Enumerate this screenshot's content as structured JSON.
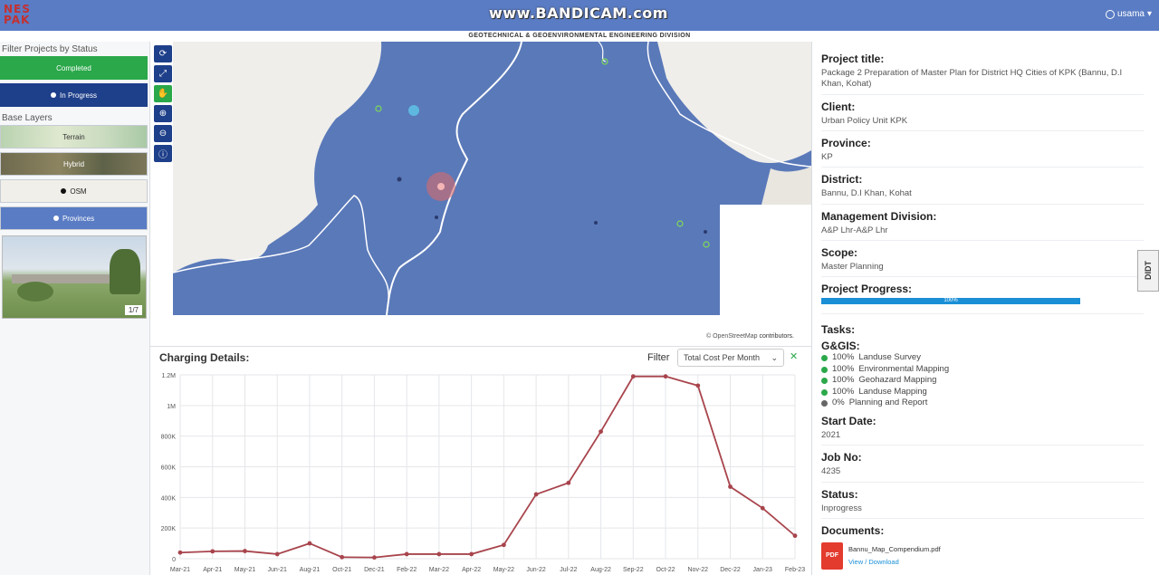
{
  "header": {
    "logo_text": "NESPAK",
    "watermark": "www.BANDICAM.com",
    "user": "usama",
    "division_title": "GEOTECHNICAL & GEOENVIRONMENTAL ENGINEERING DIVISION"
  },
  "left": {
    "filter_title": "Filter Projects by Status",
    "status_buttons": [
      "Completed",
      "In Progress"
    ],
    "base_layers_title": "Base Layers",
    "layers": [
      "Terrain",
      "Hybrid",
      "OSM",
      "Provinces"
    ],
    "photo_counter": "1/7"
  },
  "map": {
    "attribution_prefix": "© OpenStreetMap",
    "attribution_suffix": "contributors."
  },
  "charging": {
    "title": "Charging Details:",
    "filter_label": "Filter",
    "filter_value": "Total Cost Per Month",
    "close_symbol": "✕"
  },
  "chart_data": {
    "type": "line",
    "title": "",
    "xlabel": "",
    "ylabel": "",
    "x": [
      "Mar-21",
      "Apr-21",
      "May-21",
      "Jun-21",
      "Aug-21",
      "Oct-21",
      "Dec-21",
      "Feb-22",
      "Mar-22",
      "Apr-22",
      "May-22",
      "Jun-22",
      "Jul-22",
      "Aug-22",
      "Sep-22",
      "Oct-22",
      "Nov-22",
      "Dec-22",
      "Jan-23",
      "Feb-23"
    ],
    "series": [
      {
        "values": [
          40000,
          48000,
          50000,
          30000,
          100000,
          10000,
          8000,
          30000,
          30000,
          30000,
          90000,
          420000,
          495000,
          830000,
          1190000,
          1190000,
          1130000,
          470000,
          330000,
          150000
        ]
      }
    ],
    "ylim": [
      0,
      1200000
    ],
    "y_ticks": [
      "0",
      "200K",
      "400K",
      "600K",
      "800K",
      "1M",
      "1.2M"
    ],
    "grid": true,
    "line_color": "#a8444c"
  },
  "project": {
    "title_label": "Project title:",
    "title_value": "Package 2 Preparation of Master Plan for District HQ Cities of KPK (Bannu, D.I Khan, Kohat)",
    "client_label": "Client:",
    "client_value": "Urban Policy Unit KPK",
    "province_label": "Province:",
    "province_value": "KP",
    "district_label": "District:",
    "district_value": "Bannu, D.I Khan, Kohat",
    "mgmt_label": "Management Division:",
    "mgmt_value": "A&P Lhr-A&P Lhr",
    "scope_label": "Scope:",
    "scope_value": "Master Planning",
    "progress_label": "Project Progress:",
    "progress_value": "100%",
    "progress_fraction": 1.0,
    "tasks_label": "Tasks:",
    "tasks_group": "G&GIS:",
    "tasks": [
      {
        "pct": "100%",
        "name": "Landuse Survey",
        "done": true
      },
      {
        "pct": "100%",
        "name": "Environmental Mapping",
        "done": true
      },
      {
        "pct": "100%",
        "name": "Geohazard Mapping",
        "done": true
      },
      {
        "pct": "100%",
        "name": "Landuse Mapping",
        "done": true
      },
      {
        "pct": "0%",
        "name": "Planning and Report",
        "done": false
      }
    ],
    "start_label": "Start Date:",
    "start_value": "2021",
    "job_label": "Job No:",
    "job_value": "4235",
    "status_label": "Status:",
    "status_value": "Inprogress",
    "docs_label": "Documents:",
    "doc_name": "Bannu_Map_Compendium.pdf",
    "doc_view": "View",
    "doc_sep": " / ",
    "doc_download": "Download",
    "pdf_badge": "PDF"
  },
  "side_tab": "DIDT",
  "colors": {
    "header_bg": "#5a7cc4",
    "completed": "#2aa84a",
    "in_progress": "#1e3f8a",
    "progress_bar": "#1a8fd6"
  }
}
